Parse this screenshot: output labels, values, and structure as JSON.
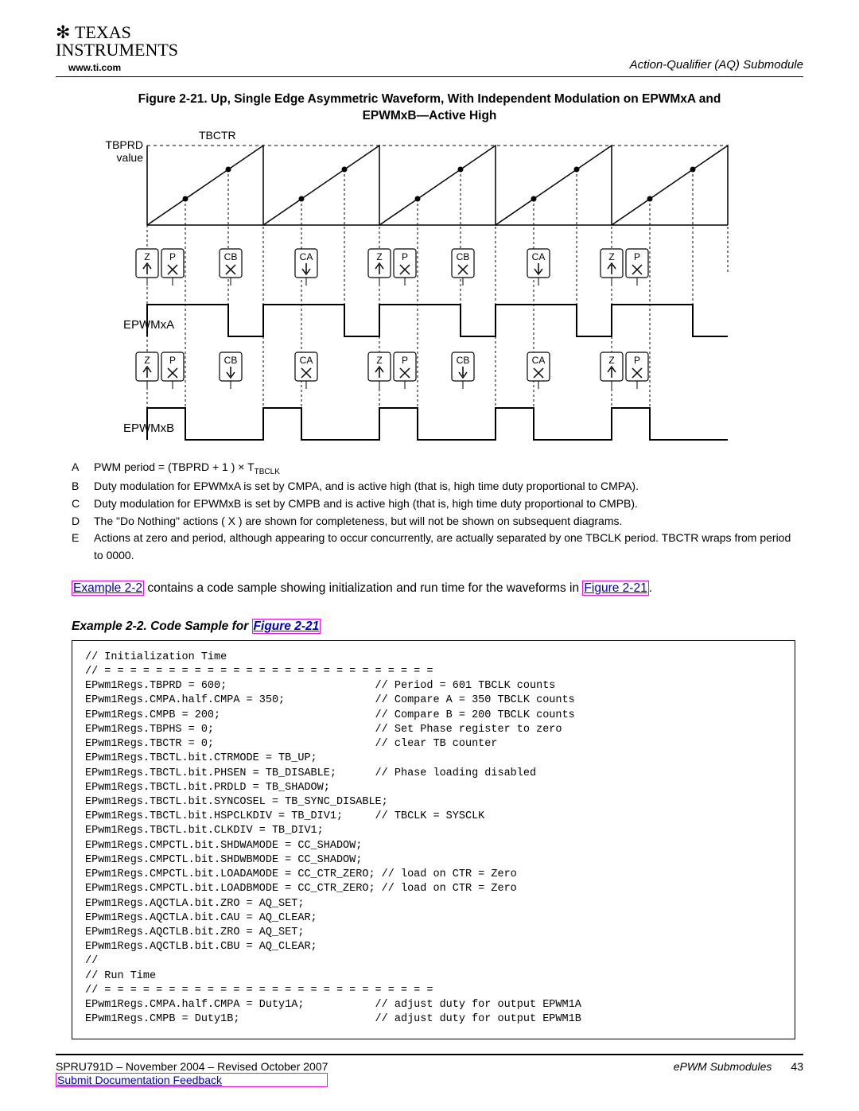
{
  "header": {
    "logo_line1": "TEXAS",
    "logo_line2": "INSTRUMENTS",
    "url": "www.ti.com",
    "section": "Action-Qualifier (AQ) Submodule"
  },
  "figure": {
    "caption_a": "Figure 2-21. Up, Single Edge Asymmetric Waveform, With Independent Modulation on EPWMxA and",
    "caption_b": "EPWMxB—Active High",
    "tbctr": "TBCTR",
    "tbprd1": "TBPRD",
    "tbprd2": "value",
    "epwmxa": "EPWMxA",
    "epwmxb": "EPWMxB",
    "ev": {
      "z": "Z",
      "p": "P",
      "cb": "CB",
      "ca": "CA"
    }
  },
  "notes": {
    "a_lbl": "A",
    "a": "PWM period = (TBPRD + 1 ) × T",
    "a_sub": "TBCLK",
    "b_lbl": "B",
    "b": "Duty modulation for EPWMxA is set by CMPA, and is active high (that is, high time duty proportional to CMPA).",
    "c_lbl": "C",
    "c": "Duty modulation for EPWMxB is set by CMPB and is active high (that is, high time duty proportional to CMPB).",
    "d_lbl": "D",
    "d": "The \"Do Nothing\" actions ( X ) are shown for completeness, but will not be shown on subsequent diagrams.",
    "e_lbl": "E",
    "e": "Actions at zero and period, although appearing to occur concurrently, are actually separated by one TBCLK period. TBCTR wraps from period to 0000."
  },
  "para": {
    "p1a": "Example 2-2",
    "p1b": " contains a code sample showing initialization and run time for the waveforms in ",
    "p1c": "Figure 2-21",
    "p1d": "."
  },
  "example": {
    "title_a": "Example 2-2. Code Sample for ",
    "title_b": "Figure 2-21"
  },
  "code": "// Initialization Time\n// = = = = = = = = = = = = = = = = = = = = = = = = = =\nEPwm1Regs.TBPRD = 600;                       // Period = 601 TBCLK counts\nEPwm1Regs.CMPA.half.CMPA = 350;              // Compare A = 350 TBCLK counts\nEPwm1Regs.CMPB = 200;                        // Compare B = 200 TBCLK counts\nEPwm1Regs.TBPHS = 0;                         // Set Phase register to zero\nEPwm1Regs.TBCTR = 0;                         // clear TB counter\nEPwm1Regs.TBCTL.bit.CTRMODE = TB_UP;\nEPwm1Regs.TBCTL.bit.PHSEN = TB_DISABLE;      // Phase loading disabled\nEPwm1Regs.TBCTL.bit.PRDLD = TB_SHADOW;\nEPwm1Regs.TBCTL.bit.SYNCOSEL = TB_SYNC_DISABLE;\nEPwm1Regs.TBCTL.bit.HSPCLKDIV = TB_DIV1;     // TBCLK = SYSCLK\nEPwm1Regs.TBCTL.bit.CLKDIV = TB_DIV1;\nEPwm1Regs.CMPCTL.bit.SHDWAMODE = CC_SHADOW;\nEPwm1Regs.CMPCTL.bit.SHDWBMODE = CC_SHADOW;\nEPwm1Regs.CMPCTL.bit.LOADAMODE = CC_CTR_ZERO; // load on CTR = Zero\nEPwm1Regs.CMPCTL.bit.LOADBMODE = CC_CTR_ZERO; // load on CTR = Zero\nEPwm1Regs.AQCTLA.bit.ZRO = AQ_SET;\nEPwm1Regs.AQCTLA.bit.CAU = AQ_CLEAR;\nEPwm1Regs.AQCTLB.bit.ZRO = AQ_SET;\nEPwm1Regs.AQCTLB.bit.CBU = AQ_CLEAR;\n//\n// Run Time\n// = = = = = = = = = = = = = = = = = = = = = = = = = =\nEPwm1Regs.CMPA.half.CMPA = Duty1A;           // adjust duty for output EPWM1A\nEPwm1Regs.CMPB = Duty1B;                     // adjust duty for output EPWM1B",
  "footer": {
    "docid": "SPRU791D – November 2004 – Revised October 2007",
    "feedback": "Submit Documentation Feedback",
    "right": "ePWM Submodules",
    "page": "43"
  }
}
